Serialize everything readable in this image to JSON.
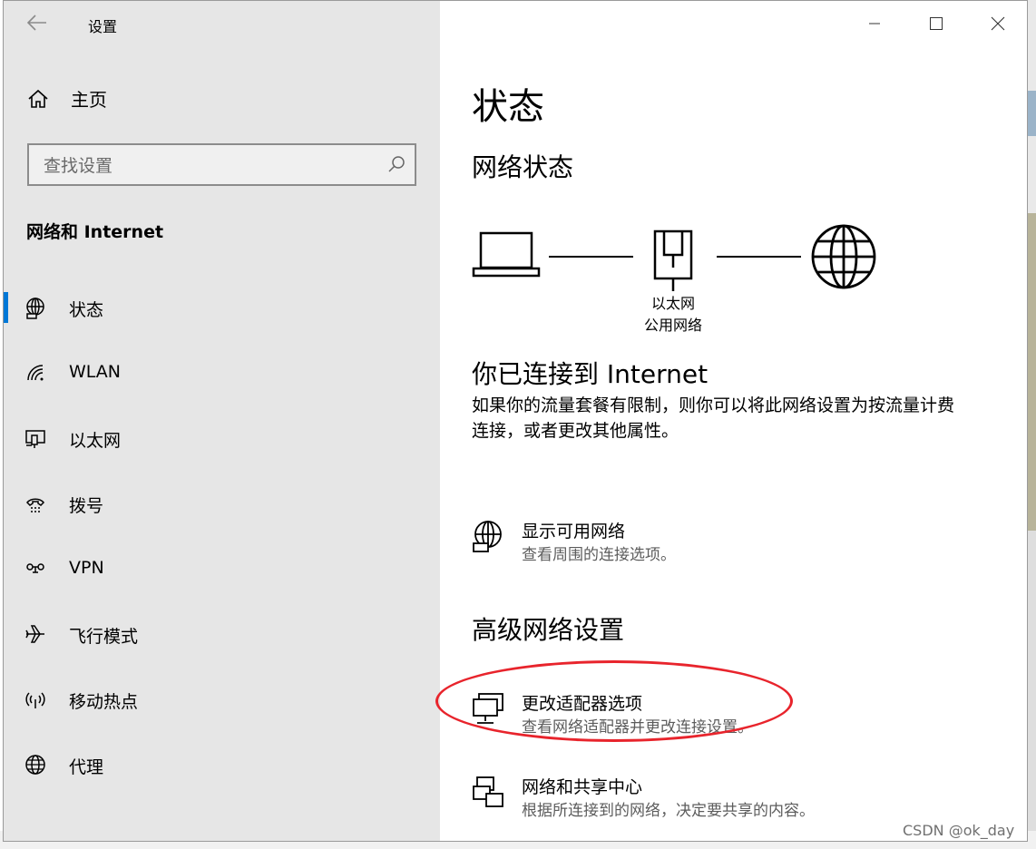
{
  "window": {
    "title": "设置",
    "controls": [
      "minimize-icon",
      "maximize-icon",
      "close-icon"
    ]
  },
  "sidebar": {
    "home_label": "主页",
    "search_placeholder": "查找设置",
    "section_title": "网络和 Internet",
    "items": [
      {
        "label": "状态",
        "icon": "globe-icon",
        "active": true
      },
      {
        "label": "WLAN",
        "icon": "wifi-icon",
        "active": false
      },
      {
        "label": "以太网",
        "icon": "ethernet-icon",
        "active": false
      },
      {
        "label": "拨号",
        "icon": "dialup-icon",
        "active": false
      },
      {
        "label": "VPN",
        "icon": "vpn-icon",
        "active": false
      },
      {
        "label": "飞行模式",
        "icon": "airplane-icon",
        "active": false
      },
      {
        "label": "移动热点",
        "icon": "hotspot-icon",
        "active": false
      },
      {
        "label": "代理",
        "icon": "proxy-icon",
        "active": false
      }
    ]
  },
  "main": {
    "page_title": "状态",
    "network_status_heading": "网络状态",
    "network_name": "以太网",
    "network_type": "公用网络",
    "connected_heading": "你已连接到 Internet",
    "connected_desc_line1": "如果你的流量套餐有限制，则你可以将此网络设置为按流量计费",
    "connected_desc_line2": "连接，或者更改其他属性。",
    "show_networks": {
      "title": "显示可用网络",
      "subtitle": "查看周围的连接选项。"
    },
    "advanced_heading": "高级网络设置",
    "adapter_options": {
      "title": "更改适配器选项",
      "subtitle": "查看网络适配器并更改连接设置。"
    },
    "sharing_center": {
      "title": "网络和共享中心",
      "subtitle": "根据所连接到的网络，决定要共享的内容。"
    }
  },
  "watermark": "CSDN @ok_day",
  "accent_color": "#0078d7",
  "annotation_color": "#e8242c"
}
